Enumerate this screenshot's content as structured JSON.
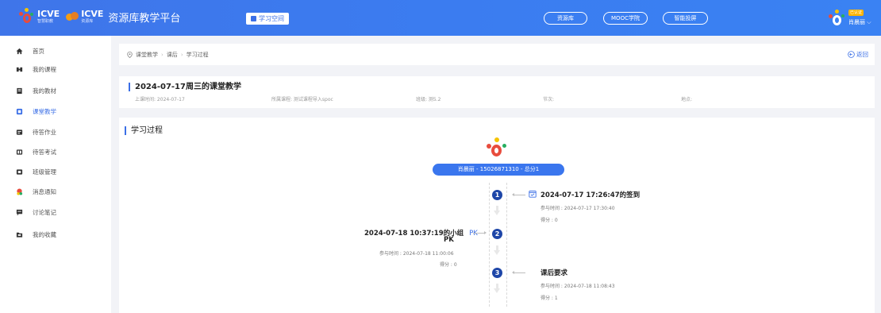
{
  "header": {
    "brand_left": "icve",
    "brand_left_sub": "智慧职教",
    "brand_right": "icve",
    "brand_right_sub": "资源库",
    "platform_title": "资源库教学平台",
    "study_space_label": "学习空间",
    "pills": [
      "资源库",
      "MOOC学院",
      "智能投屏"
    ],
    "user_badge": "已认证",
    "user_name": "肖晨丽"
  },
  "sidebar": {
    "items": [
      {
        "label": "首页",
        "icon": "home-icon"
      },
      {
        "label": "我的课程",
        "icon": "course-icon"
      },
      {
        "label": "我的教材",
        "icon": "book-icon"
      },
      {
        "label": "课堂教学",
        "icon": "classroom-icon",
        "active": true
      },
      {
        "label": "待答作业",
        "icon": "homework-icon"
      },
      {
        "label": "待答考试",
        "icon": "exam-icon"
      },
      {
        "label": "班级管理",
        "icon": "class-icon"
      },
      {
        "label": "消息通知",
        "icon": "message-icon"
      },
      {
        "label": "讨论笔记",
        "icon": "discussion-icon"
      },
      {
        "label": "我的收藏",
        "icon": "folder-icon"
      }
    ]
  },
  "breadcrumb": {
    "items": [
      "课堂教学",
      "课后",
      "学习过程"
    ],
    "back_label": "返回"
  },
  "lesson": {
    "title": "2024-07-17周三的课堂教学",
    "class_time": "上课时间: 2024-07-17",
    "course": "所属课程: 测试课程导入spoc",
    "class_name": "班级: 测5.2",
    "section": "节次:",
    "location": "地点:"
  },
  "process": {
    "title": "学习过程",
    "student_summary": "肖晨丽 - 15026871310 - 总分1",
    "events": [
      {
        "num": "1",
        "title": "2024-07-17 17:26:47的签到",
        "time": "参与时间 : 2024-07-17 17:30:40",
        "score": "得分 : 0"
      },
      {
        "num": "2",
        "title": "2024-07-18 10:37:19的小组",
        "pk": "PK",
        "title_line2": "PK",
        "time": "参与时间 : 2024-07-18 11:00:06",
        "score": "得分 : 0"
      },
      {
        "num": "3",
        "title": "课后要求",
        "time": "参与时间 : 2024-07-18 11:08:43",
        "score": "得分 : 1"
      }
    ]
  },
  "colors": {
    "primary": "#3b6fe6",
    "node": "#1e46a8",
    "header_bg": "#3f75e9"
  }
}
